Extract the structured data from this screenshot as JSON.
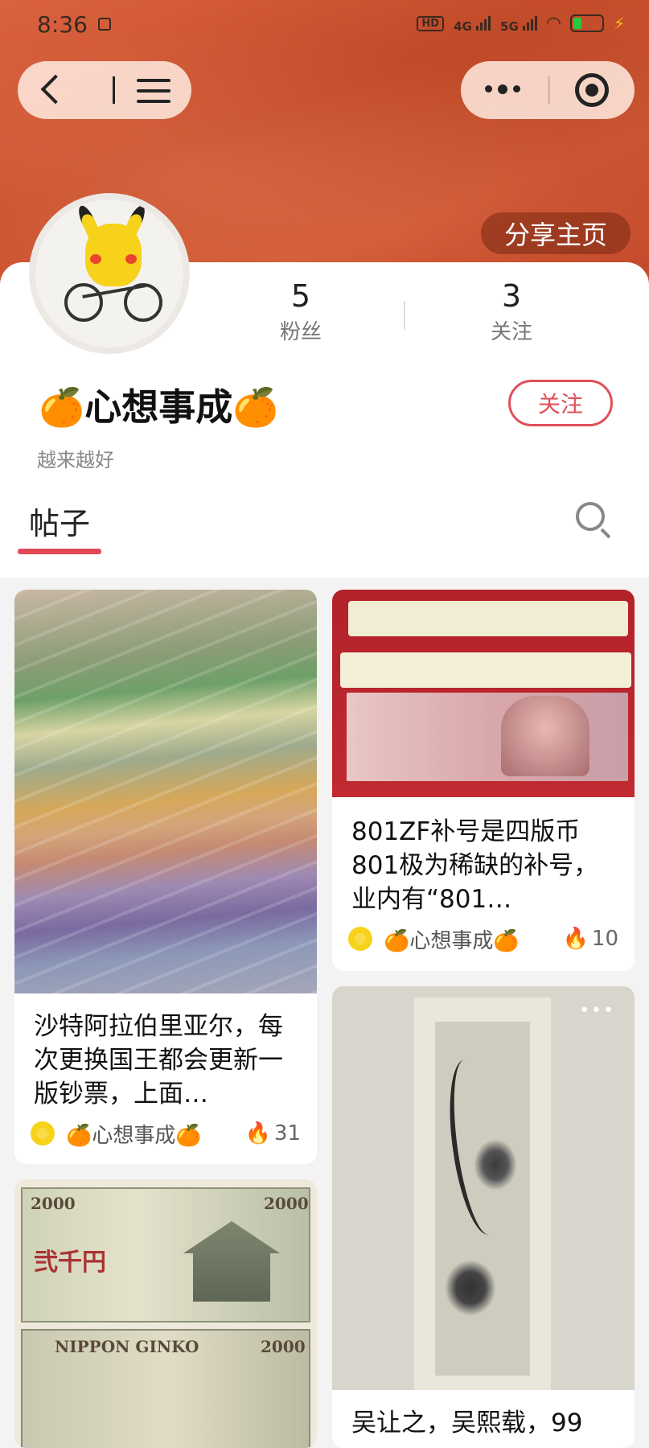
{
  "status_bar": {
    "time": "8:36",
    "network_hd": "HD",
    "network_4g": "4G",
    "network_5g": "5G"
  },
  "header": {
    "share_label": "分享主页"
  },
  "profile": {
    "fans_count": "5",
    "fans_label": "粉丝",
    "follow_count": "3",
    "follow_label": "关注",
    "nickname": "🍊心想事成🍊",
    "follow_button": "关注",
    "bio": "越来越好"
  },
  "tabs": {
    "posts": "帖子"
  },
  "posts": [
    {
      "title": "沙特阿拉伯里亚尔，每次更换国王都会更新一版钞票，上面…",
      "author": "🍊心想事成🍊",
      "heat": "31"
    },
    {
      "title": "801ZF补号是四版币801极为稀缺的补号，业内有“801…",
      "author": "🍊心想事成🍊",
      "heat": "10"
    },
    {
      "title": "吴让之，吴熙载，99",
      "author": "",
      "heat": ""
    },
    {
      "title": "",
      "author": "",
      "heat": ""
    }
  ],
  "colors": {
    "banner": "#c94f2c",
    "accent": "#e24a56",
    "card_bg": "#ffffff",
    "page_bg": "#f3f3f3"
  },
  "icons": {
    "back": "back-arrow-icon",
    "menu": "hamburger-menu-icon",
    "more": "more-dots-icon",
    "record": "record-target-icon",
    "search": "search-icon",
    "fire": "fire-icon"
  }
}
